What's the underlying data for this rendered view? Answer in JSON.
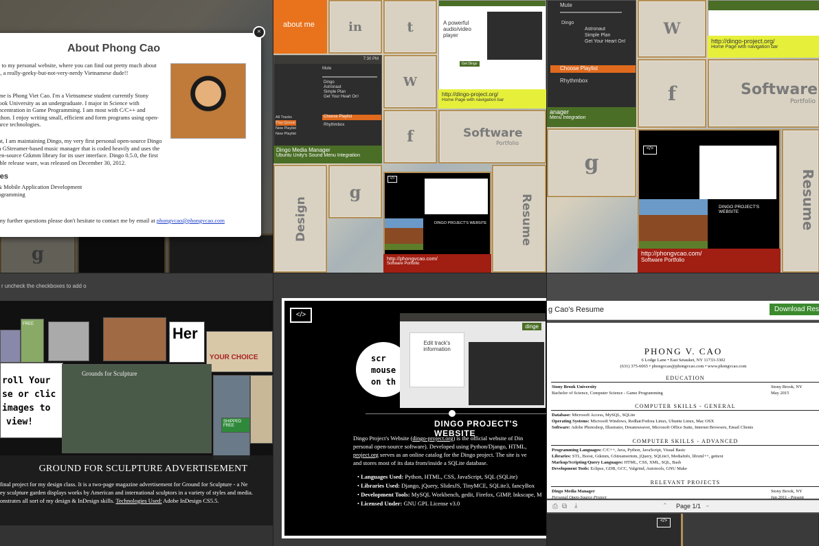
{
  "panel1": {
    "modal_title": "About Phong Cao",
    "close_label": "×",
    "intro": "me to my personal website, where you can find out pretty much about me, a really-geeky-but-not-very-nerdy Vietnamese dude!!",
    "bio": "name is Phong Viet Cao. I'm a Vietnamese student currently Stony Brook University as an undergraduate. I major in Science with concentration in Game Programming. I am most with C/C++ and Python. I enjoy writing small, efficient and form programs using open-source technologies.",
    "project": "sent, I am maintaining Dingo, my very first personal open-source Dingo is a GStreamer-based music manager that is coded heavily and uses the open-source Gtkmm library for its user interface. Dingo 0.5.0, the first stable release ware, was released on December 30, 2012.",
    "specialties_heading": "lties",
    "specialties": [
      "p & Mobile Application Development",
      "Programming"
    ],
    "contact_heading": "t",
    "contact_text": "e any further questions please don't hesitate to contact me by email at",
    "email": "phongvcao@phongvcao.com",
    "tile_glyph": "g"
  },
  "panel2": {
    "about_me": "about me",
    "linkedin": "in",
    "twitter": "t",
    "wordpress": "W",
    "facebook": "f",
    "goodreads": "g",
    "software": "Software",
    "portfolio": "Portfolio",
    "design": "Design",
    "resume": "Resume",
    "dingo_bar_title": "Dingo Media Manager",
    "dingo_bar_sub": "Ubuntu Unity's Sound Menu Integration",
    "dingo_site_url": "http://dingo-project.org/",
    "dingo_site_sub": "Home Page with navigation bar",
    "phong_site_url": "http://phongvcao.com/",
    "phong_site_sub": "Software Portfolio",
    "clock": "7:30 PM",
    "mute": "Mute",
    "player_lines": [
      "Dingo",
      "Astronaut",
      "Simple Plan",
      "Get Your Heart On!"
    ],
    "choose_playlist": "Choose Playlist",
    "rhythmbox": "Rhythmbox",
    "all_tracks": "All Tracks",
    "play_queue": "Play Queue",
    "new_playlist": "New Playlist",
    "web_headline": "A powerful audio/video player",
    "dingo_project_title": "DINGO PROJECT'S WEBSITE",
    "get_dingo": "Get Dingo"
  },
  "panel3": {
    "mute": "Mute",
    "player_lines": [
      "Dingo",
      "Astronaut",
      "Simple Plan",
      "Get Your Heart On!"
    ],
    "choose_playlist": "Choose Playlist",
    "rhythmbox": "Rhythmbox",
    "manager": "anager",
    "menu_integration": "Menu Integration",
    "dingo_site_url": "http://dingo-project.org/",
    "dingo_site_sub": "Home Page with navigation bar",
    "software": "Software",
    "portfolio": "Portfolio",
    "resume": "Resume",
    "phong_site_url": "http://phongvcao.com/",
    "phong_site_sub": "Software Portfolio",
    "dingo_project_title": "DINGO PROJECT'S WEBSITE",
    "wordpress": "W",
    "facebook": "f",
    "goodreads": "g"
  },
  "panel4": {
    "strip_text": "r uncheck the checkboxes to add o",
    "overlay_lines": [
      "roll Your",
      "se or clic",
      "images to",
      "view!"
    ],
    "caption_title": "GROUND FOR SCULPTURE ADVERTISEMENT",
    "caption_lines": [
      "final project for my design class. It is a two-page magazine advertisement for Ground for Sculpture - a Ne",
      "ey sculpture garden displays works by American and international sculptors in a variety of styles and media.",
      "onstrates all sort of my design & InDesign skills."
    ],
    "technologies_label": "Technologies Used:",
    "technologies_value": "Adobe InDesign CS5.5.",
    "collage_labels": [
      "Grounds for Sculpture",
      "YOUR CHOICE",
      "FREE",
      "SHIPPED FREE",
      "Her"
    ],
    "code_icon": "</>"
  },
  "panel5": {
    "code_icon": "</>",
    "title": "DINGO PROJECT'S WEBSITE",
    "desc_prefix": "Dingo Project's Website (",
    "desc_link": "dingo-project.org",
    "desc_mid": ") is the official website of Din",
    "desc_line2": "personal open-source software). Developed using Python/Django, HTML,",
    "desc_link2": "project.org",
    "desc_line3": " serves as an online catalog for the Dingo project. The site is ve",
    "desc_line4": "and stores most of its data from/inside a SQLite database.",
    "items": [
      {
        "label": "Languages Used:",
        "value": "Python, HTML, CSS, JavaScript, SQL (SQLite)"
      },
      {
        "label": "Libraries Used:",
        "value": "Django, jQuery, SlidesJS, TinyMCE, SQLite3, fancyBox"
      },
      {
        "label": "Development Tools:",
        "value": "MySQL Workbench, gedit, Firefox, GIMP, Inkscape, M"
      },
      {
        "label": "Licensed Under:",
        "value": "GNU GPL License v3.0"
      }
    ],
    "screen_text": "Edit track's information",
    "dingo_brand": "dinge",
    "side_text": [
      "scr",
      "mouse",
      "on th"
    ]
  },
  "panel6": {
    "page_title": "g Cao's Resume",
    "download_label": "Download Res",
    "name": "PHONG V. CAO",
    "address": "6 Lodge Lane • East Setauket, NY 11733-3302",
    "contact": "(631) 375-6065 • phongvcao@phongvcao.com • www.phongvcao.com",
    "education_heading": "EDUCATION",
    "school": "Stony Brook University",
    "school_loc": "Stony Brook, NY",
    "degree": "Bachelor of Science, Computer Science - Game Programming",
    "degree_date": "May 2015",
    "general_heading": "COMPUTER SKILLS - GENERAL",
    "general": [
      {
        "label": "Database:",
        "value": "Microsoft Access, MySQL, SQLite"
      },
      {
        "label": "Operating Systems:",
        "value": "Microsoft Windows, Redhat/Fedora Linux, Ubuntu Linux, Mac OSX"
      },
      {
        "label": "Software:",
        "value": "Adobe Photoshop, Illustrator, Dreamweaver, Microsoft Office Suite, Internet Browsers, Email Clients"
      }
    ],
    "advanced_heading": "COMPUTER SKILLS - ADVANCED",
    "advanced": [
      {
        "label": "Programming Languages:",
        "value": "C/C++, Java, Python, JavaScript, Visual Basic"
      },
      {
        "label": "Libraries:",
        "value": "STL, Boost, Gtkmm, GStreamermm, jQuery, SQLite3, MediaInfo, libxml++, gettext"
      },
      {
        "label": "Markup/Scripting/Query Languages:",
        "value": "HTML, CSS, XML, SQL, Bash"
      },
      {
        "label": "Development Tools:",
        "value": "Eclipse, GDB, GCC, Valgrind, Autotools, GNU Make"
      }
    ],
    "projects_heading": "RELEVANT PROJECTS",
    "project_title": "Dingo Media Manager",
    "project_loc": "Stony Brook, NY",
    "project_sub": "Personal Open-Source Project",
    "project_date": "Jun 2011 - Present",
    "page_indicator": "Page 1/1",
    "code_icon": "</>"
  }
}
